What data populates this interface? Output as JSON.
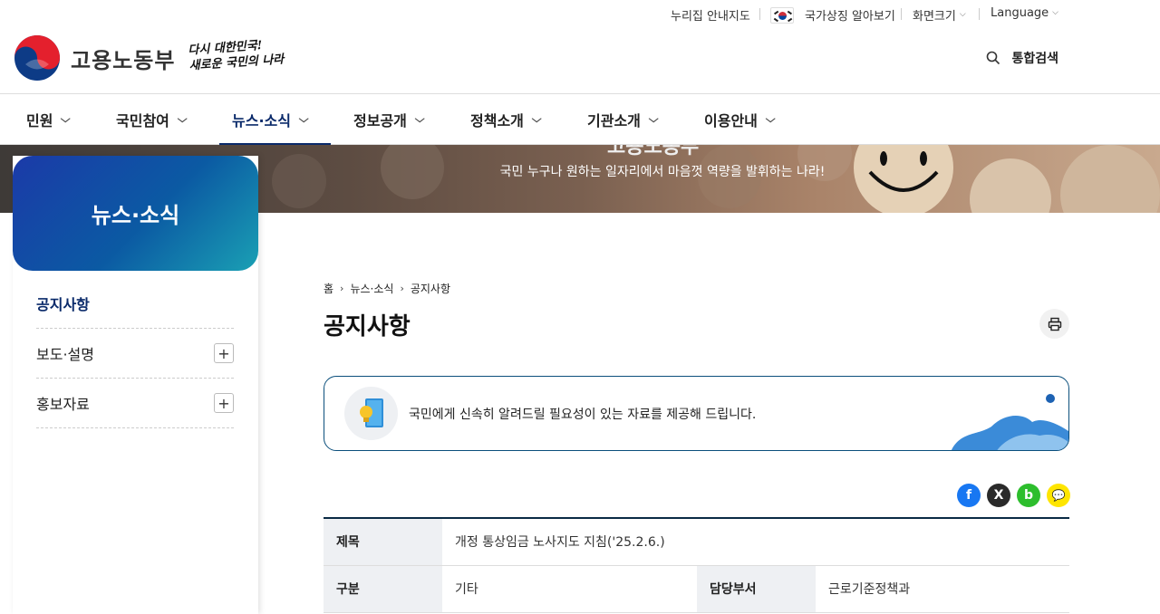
{
  "utility": {
    "sitemap": "누리집 안내지도",
    "symbols": "국가상징 알아보기",
    "screen_size": "화면크기",
    "language": "Language"
  },
  "header": {
    "ministry_name": "고용노동부",
    "slogan_line1": "다시 대한민국!",
    "slogan_line2": "새로운 국민의 나라",
    "search_label": "통합검색"
  },
  "nav": {
    "items": [
      {
        "label": "민원"
      },
      {
        "label": "국민참여"
      },
      {
        "label": "뉴스·소식"
      },
      {
        "label": "정보공개"
      },
      {
        "label": "정책소개"
      },
      {
        "label": "기관소개"
      },
      {
        "label": "이용안내"
      }
    ]
  },
  "banner": {
    "title": "고용노동부",
    "subtitle": "국민 누구나 원하는 일자리에서 마음껏 역량을 발휘하는 나라!"
  },
  "sidebar": {
    "title": "뉴스·소식",
    "items": [
      {
        "label": "공지사항"
      },
      {
        "label": "보도·설명"
      },
      {
        "label": "홍보자료"
      }
    ]
  },
  "breadcrumb": {
    "home": "홈",
    "level1": "뉴스·소식",
    "level2": "공지사항"
  },
  "page": {
    "title": "공지사항",
    "intro": "국민에게 신속히 알려드릴 필요성이 있는 자료를 제공해 드립니다."
  },
  "share": {
    "facebook": "f",
    "x": "X",
    "band": "b",
    "kakao": "💬"
  },
  "detail": {
    "title_label": "제목",
    "title_value": "개정 통상임금 노사지도 지침('25.2.6.)",
    "category_label": "구분",
    "category_value": "기타",
    "dept_label": "담당부서",
    "dept_value": "근로기준정책과"
  },
  "colors": {
    "brand_navy": "#0a2a6a",
    "lnb_gradient_start": "#1b3aa8",
    "lnb_gradient_end": "#1aa0b4",
    "facebook": "#1877f2",
    "x": "#222222",
    "band": "#2dbe2d",
    "kakao": "#fee500"
  }
}
